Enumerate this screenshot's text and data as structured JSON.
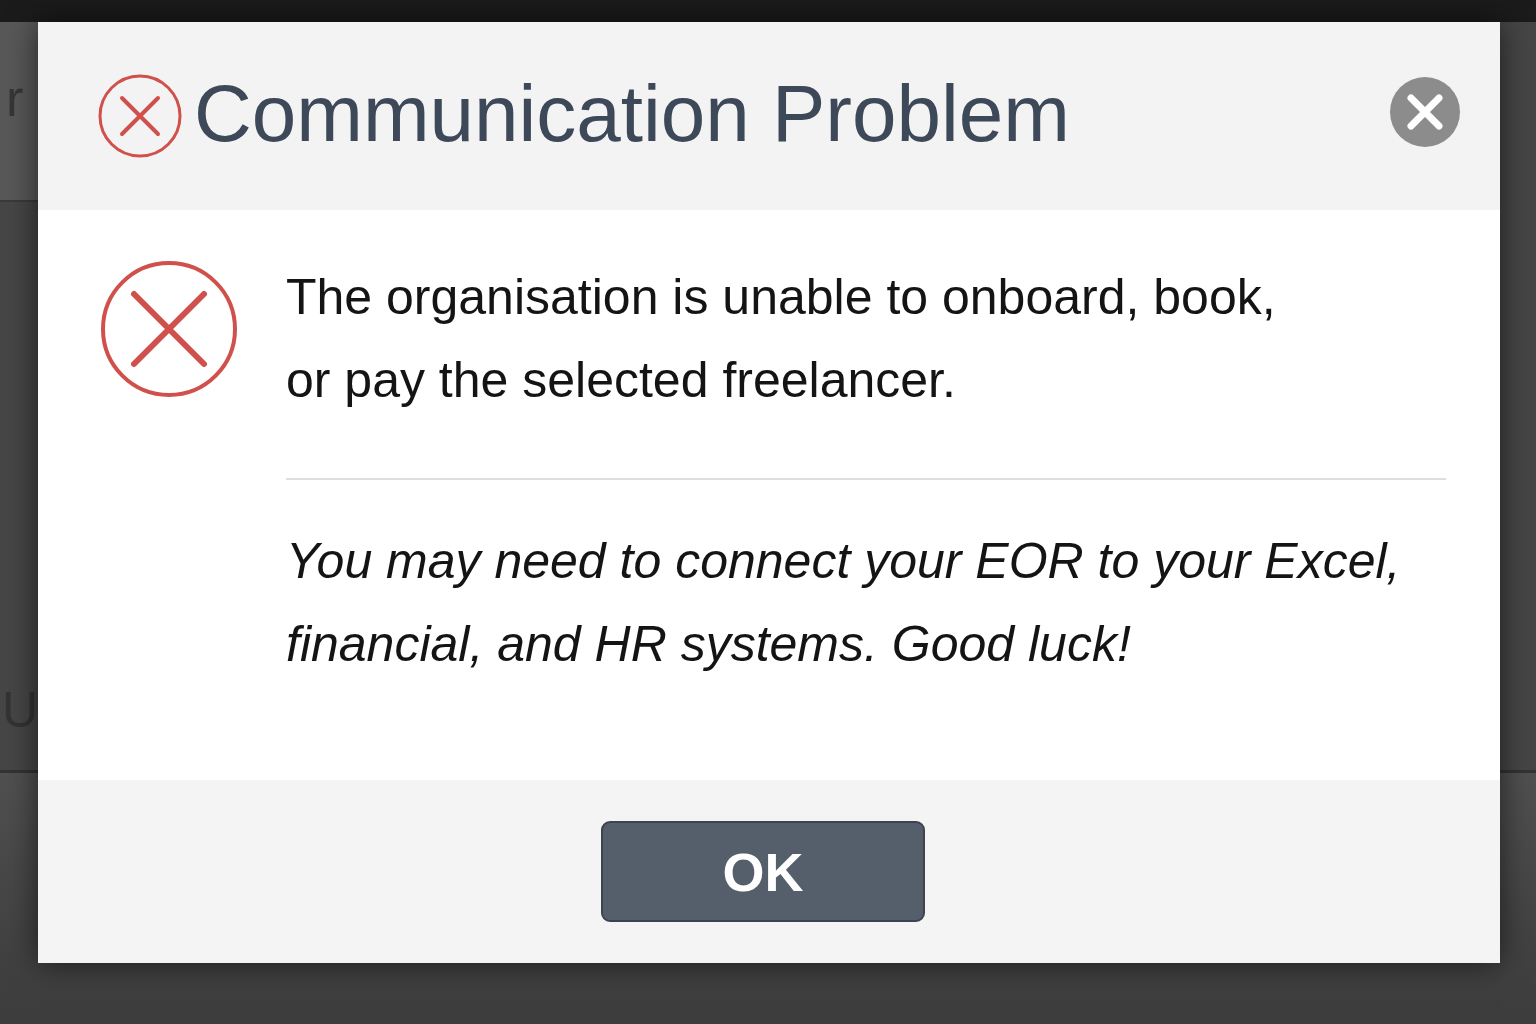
{
  "background": {
    "fragments": [
      {
        "text": "r"
      },
      {
        "text": "U"
      }
    ]
  },
  "dialog": {
    "title": "Communication Problem",
    "message": "The organisation is unable to onboard, book, or pay the selected freelancer.",
    "detail": "You may need to connect your EOR to your Excel, financial, and HR systems. Good luck!",
    "buttons": [
      {
        "label": "OK"
      }
    ]
  }
}
